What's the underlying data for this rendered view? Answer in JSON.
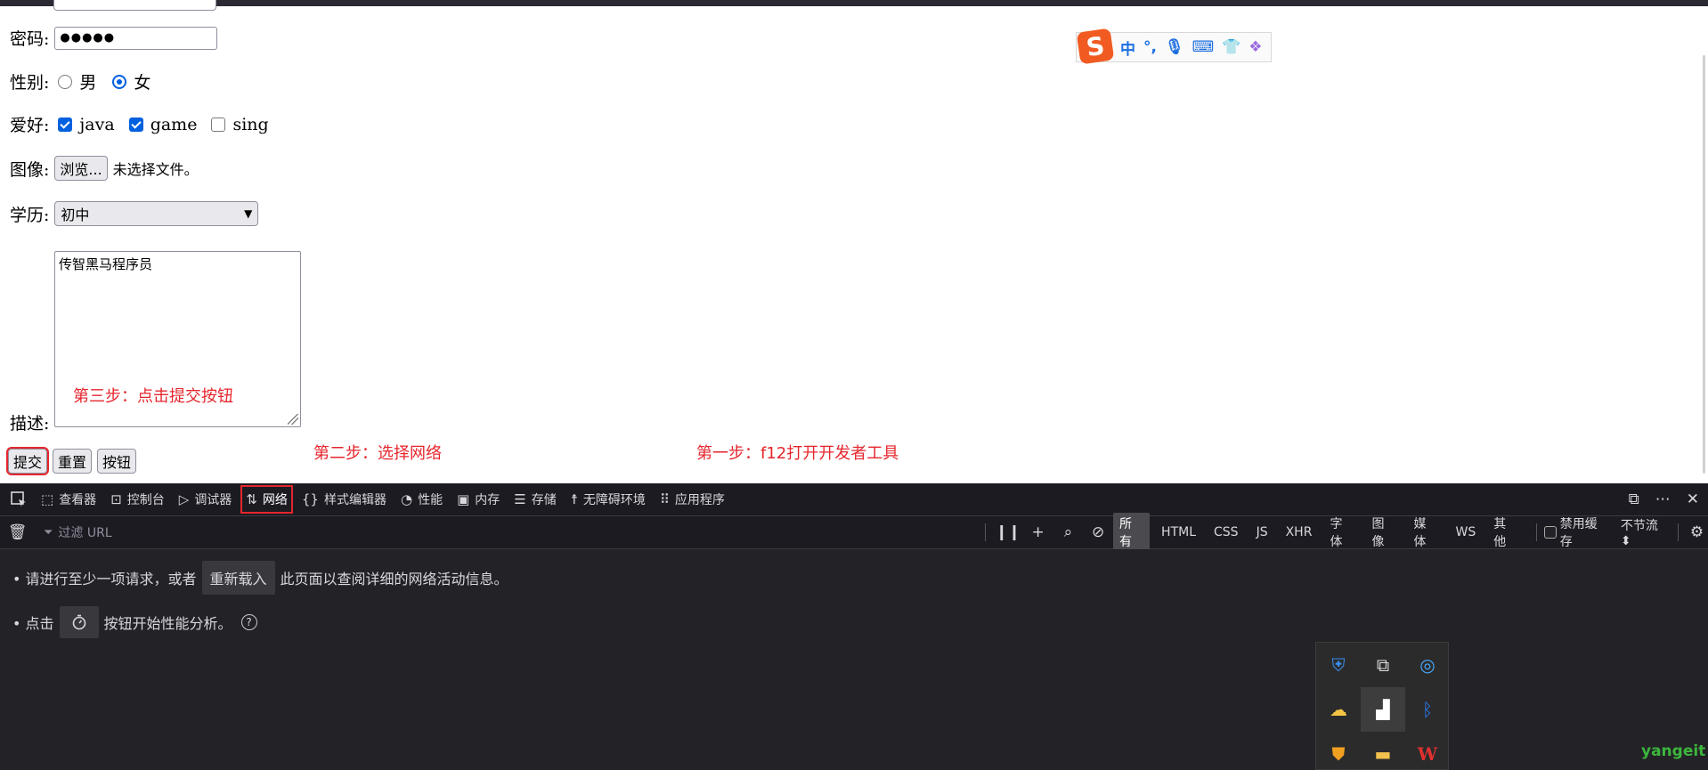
{
  "form": {
    "password_label": "密码:",
    "password_value": "●●●●●",
    "gender_label": "性别:",
    "gender_options": [
      "男",
      "女"
    ],
    "gender_selected": "女",
    "hobby_label": "爱好:",
    "hobbies": [
      {
        "label": "java",
        "checked": true
      },
      {
        "label": "game",
        "checked": true
      },
      {
        "label": "sing",
        "checked": false
      }
    ],
    "image_label": "图像:",
    "browse_button": "浏览...",
    "file_status": "未选择文件。",
    "edu_label": "学历:",
    "edu_selected": "初中",
    "desc_label": "描述:",
    "desc_value": "传智黑马程序员",
    "buttons": {
      "submit": "提交",
      "reset": "重置",
      "button": "按钮"
    }
  },
  "annotations": {
    "step1": "第一步：f12打开开发者工具",
    "step2": "第二步：选择网络",
    "step3": "第三步：点击提交按钮"
  },
  "ime": {
    "logo": "S",
    "mode": "中",
    "punct": "°,"
  },
  "devtools": {
    "tabs": [
      {
        "label": "查看器",
        "icon": "inspector-icon"
      },
      {
        "label": "控制台",
        "icon": "console-icon"
      },
      {
        "label": "调试器",
        "icon": "debugger-icon"
      },
      {
        "label": "网络",
        "icon": "network-icon",
        "active": true
      },
      {
        "label": "样式编辑器",
        "icon": "style-editor-icon"
      },
      {
        "label": "性能",
        "icon": "performance-icon"
      },
      {
        "label": "内存",
        "icon": "memory-icon"
      },
      {
        "label": "存储",
        "icon": "storage-icon"
      },
      {
        "label": "无障碍环境",
        "icon": "accessibility-icon"
      },
      {
        "label": "应用程序",
        "icon": "application-icon"
      }
    ],
    "filter_placeholder": "过滤 URL",
    "type_filters": [
      "所有",
      "HTML",
      "CSS",
      "JS",
      "XHR",
      "字体",
      "图像",
      "媒体",
      "WS",
      "其他"
    ],
    "type_selected": "所有",
    "disable_cache": "禁用缓存",
    "throttle": "不节流",
    "msg1_prefix": "• 请进行至少一项请求，或者",
    "reload_button": "重新载入",
    "msg1_suffix": "此页面以查阅详细的网络活动信息。",
    "msg2_prefix": "• 点击",
    "msg2_suffix": "按钮开始性能分析。"
  },
  "watermark": "yangeit",
  "colors": {
    "annotation": "#e5262d",
    "accent": "#0060df",
    "devtools_bg": "#232327"
  }
}
